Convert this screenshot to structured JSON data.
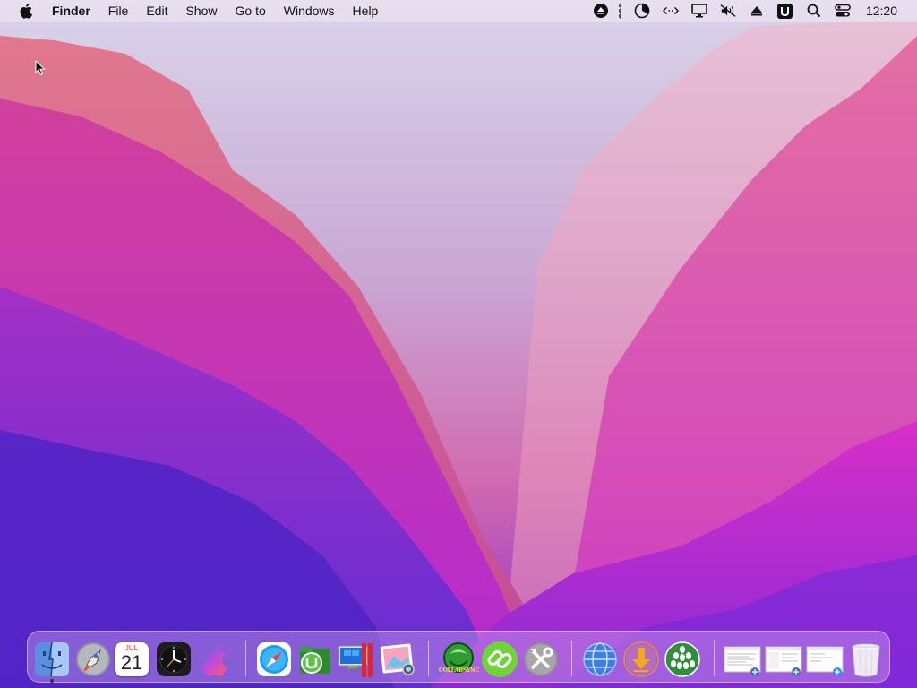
{
  "menubar": {
    "app_name": "Finder",
    "items": [
      "File",
      "Edit",
      "Show",
      "Go to",
      "Windows",
      "Help"
    ],
    "clock": "12:20",
    "status_icons": [
      "eject-icon",
      "network-monitor-icon",
      "disk-usage-icon",
      "code-icon",
      "display-icon",
      "mute-icon",
      "upload-icon",
      "u-app-icon",
      "search-icon",
      "control-center-icon"
    ]
  },
  "dock": {
    "calendar": {
      "month": "JUL",
      "day": "21"
    },
    "colllabsyn_label": "COLLABSYNC",
    "apps": [
      "finder",
      "launchpad",
      "calendar",
      "clock",
      "siri",
      "safari",
      "utorrent",
      "parallels",
      "preview",
      "collabsync",
      "link-manager",
      "system-tools",
      "network-utility",
      "downloader",
      "pod-manager",
      "window-thumb-1",
      "window-thumb-2",
      "window-thumb-3",
      "trash"
    ]
  },
  "colors": {
    "menubar_bg": "#ece2f0",
    "accent_pink": "#d33fb6",
    "accent_purple": "#6a2ad8"
  }
}
